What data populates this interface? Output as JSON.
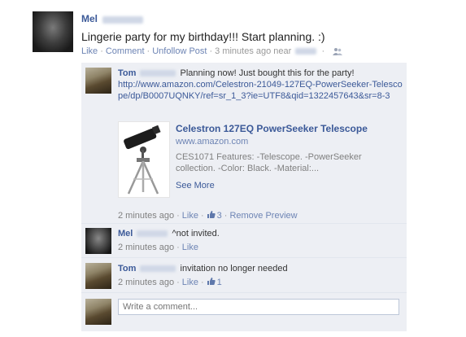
{
  "post": {
    "author": "Mel",
    "text": "Lingerie party for my birthday!!! Start planning. :)",
    "actions": [
      "Like",
      "Comment",
      "Unfollow Post"
    ],
    "timestamp": "3 minutes ago near",
    "friends_icon": "friends-icon"
  },
  "comments": [
    {
      "author": "Tom",
      "text": "Planning now! Just bought this for the party!",
      "url": "http://www.amazon.com/Celestron-21049-127EQ-PowerSeeker-Telescope/dp/B0007UQNKY/ref=sr_1_3?ie=UTF8&qid=1322457643&sr=8-3",
      "link_preview": {
        "title": "Celestron 127EQ PowerSeeker Telescope",
        "domain": "www.amazon.com",
        "description": "CES1071 Features: -Telescope. -PowerSeeker collection. -Color: Black. -Material:...",
        "see_more": "See More"
      },
      "timestamp": "2 minutes ago",
      "like_label": "Like",
      "like_count": "3",
      "extra_action": "Remove Preview"
    },
    {
      "author": "Mel",
      "text": "^not invited.",
      "timestamp": "2 minutes ago",
      "like_label": "Like"
    },
    {
      "author": "Tom",
      "text": "invitation no longer needed",
      "timestamp": "2 minutes ago",
      "like_label": "Like",
      "like_count": "1"
    }
  ],
  "composer": {
    "placeholder": "Write a comment..."
  },
  "colors": {
    "link": "#3b5998",
    "ufi_bg": "#edeff4",
    "meta": "#808080"
  }
}
